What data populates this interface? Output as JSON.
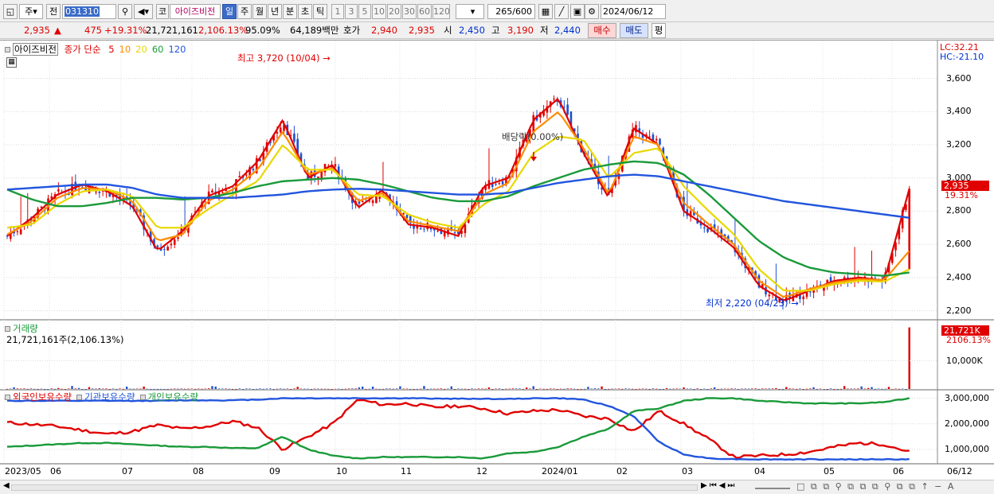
{
  "toolbar": {
    "market_type": "주",
    "prev_label": "전",
    "code": "031310",
    "market_badge": "코",
    "stock_name": "아이즈비전",
    "period_tabs": [
      "일",
      "주",
      "월",
      "년",
      "분",
      "초",
      "틱"
    ],
    "intervals": [
      "1",
      "3",
      "5",
      "10",
      "20",
      "30",
      "60",
      "120"
    ],
    "count": "265",
    "count_total": "/600",
    "date": "2024/06/12"
  },
  "quote": {
    "price": "2,935",
    "change_symbol": "▲",
    "change": "475",
    "change_pct": "+19.31%",
    "volume": "21,721,161",
    "volume_pct": "2,106.13%",
    "ratio": "95.09%",
    "amount": "64,189백만",
    "ask_label": "호가",
    "ask1": "2,940",
    "bid1": "2,935",
    "open_label": "시",
    "open": "2,450",
    "high_label": "고",
    "high": "3,190",
    "low_label": "저",
    "low": "2,440",
    "buy_btn": "매수",
    "sell_btn": "매도",
    "avg_btn": "평"
  },
  "price_panel": {
    "stock_name": "아이즈비전",
    "ma_label": "종가 단순",
    "ma_periods": [
      {
        "label": "5",
        "color": "#e00000"
      },
      {
        "label": "10",
        "color": "#ff8c00"
      },
      {
        "label": "20",
        "color": "#e8d800"
      },
      {
        "label": "60",
        "color": "#1a9a3a"
      },
      {
        "label": "120",
        "color": "#2255dd"
      }
    ],
    "high_annotation": "최고 3,720 (10/04)",
    "low_annotation": "최저 2,220 (04/23)",
    "dividend_annotation": "배당락(0.00%)",
    "lc_label": "LC:32.21",
    "hc_label": "HC:-21.10",
    "current_price_tag": "2,935",
    "current_pct_tag": "19.31%",
    "y_ticks": [
      "3,600",
      "3,400",
      "3,200",
      "3,000",
      "2,800",
      "2,600",
      "2,400",
      "2,200"
    ]
  },
  "volume_panel": {
    "title": "거래량",
    "value_text": "21,721,161주(2,106.13%)",
    "tag_value": "21,721K",
    "tag_pct": "2106.13%",
    "y_tick": "10,000K"
  },
  "holdings_panel": {
    "legend": [
      {
        "label": "외국인보유수량",
        "color": "#e00000"
      },
      {
        "label": "기관보유수량",
        "color": "#2255dd"
      },
      {
        "label": "개인보유수량",
        "color": "#1a9a3a"
      }
    ],
    "y_ticks": [
      "3,000,000",
      "2,000,000",
      "1,000,000"
    ]
  },
  "x_axis": [
    "2023/05",
    "06",
    "07",
    "08",
    "09",
    "10",
    "11",
    "12",
    "2024/01",
    "02",
    "03",
    "04",
    "05",
    "06",
    "06/12"
  ],
  "chart_data": {
    "type": "line",
    "title": "아이즈비전",
    "ylim": [
      2150,
      3780
    ],
    "x_range": [
      "2023/05",
      "2024/06/12"
    ],
    "series": [
      {
        "name": "5",
        "values": [
          2650,
          2760,
          2900,
          2960,
          2920,
          2830,
          2560,
          2680,
          2890,
          2950,
          3100,
          3350,
          3000,
          3080,
          2820,
          2930,
          2720,
          2700,
          2650,
          2950,
          3000,
          3350,
          3480,
          3150,
          2880,
          3300,
          3200,
          2800,
          2700,
          2580,
          2350,
          2260,
          2320,
          2380,
          2400,
          2380,
          2935
        ]
      },
      {
        "name": "10",
        "values": [
          2660,
          2740,
          2880,
          2940,
          2930,
          2860,
          2620,
          2660,
          2860,
          2930,
          3050,
          3280,
          3020,
          3060,
          2860,
          2910,
          2740,
          2710,
          2680,
          2900,
          2970,
          3280,
          3400,
          3180,
          2900,
          3250,
          3200,
          2850,
          2720,
          2600,
          2380,
          2280,
          2330,
          2370,
          2390,
          2385,
          2560
        ]
      },
      {
        "name": "20",
        "values": [
          2700,
          2720,
          2840,
          2920,
          2930,
          2890,
          2700,
          2700,
          2810,
          2900,
          2980,
          3200,
          3050,
          3050,
          2900,
          2890,
          2780,
          2730,
          2700,
          2840,
          2920,
          3150,
          3250,
          3230,
          3000,
          3150,
          3180,
          2950,
          2800,
          2660,
          2450,
          2320,
          2320,
          2360,
          2380,
          2375,
          2450
        ]
      },
      {
        "name": "60",
        "values": [
          2930,
          2870,
          2830,
          2830,
          2850,
          2880,
          2880,
          2870,
          2880,
          2910,
          2950,
          2980,
          2990,
          3000,
          2990,
          2960,
          2920,
          2880,
          2860,
          2860,
          2890,
          2950,
          3000,
          3050,
          3080,
          3100,
          3090,
          3020,
          2900,
          2760,
          2620,
          2520,
          2460,
          2430,
          2420,
          2410,
          2430
        ]
      },
      {
        "name": "120",
        "values": [
          2930,
          2940,
          2950,
          2960,
          2960,
          2940,
          2900,
          2880,
          2880,
          2880,
          2890,
          2900,
          2920,
          2930,
          2935,
          2930,
          2920,
          2910,
          2900,
          2900,
          2910,
          2940,
          2970,
          2990,
          3010,
          3020,
          3010,
          2980,
          2950,
          2920,
          2890,
          2860,
          2840,
          2820,
          2800,
          2780,
          2760
        ]
      }
    ],
    "holdings": {
      "ylim": [
        500000,
        3300000
      ],
      "series": [
        {
          "name": "외국인보유수량",
          "values": [
            2050000,
            1980000,
            1900000,
            1750000,
            1600000,
            1700000,
            1950000,
            1800000,
            1900000,
            2100000,
            1850000,
            1000000,
            1500000,
            2000000,
            2950000,
            2750000,
            2800000,
            2650000,
            2700000,
            2600000,
            2400000,
            2500000,
            2550000,
            2300000,
            2200000,
            1700000,
            2500000,
            2000000,
            1400000,
            700000,
            750000,
            800000,
            900000,
            1100000,
            1250000,
            1200000,
            900000
          ]
        },
        {
          "name": "기관보유수량",
          "values": [
            2900000,
            2900000,
            2900000,
            2900000,
            2900000,
            2900000,
            2900000,
            2920000,
            2920000,
            2920000,
            2950000,
            3000000,
            3000000,
            3000000,
            3000000,
            3000000,
            3000000,
            2990000,
            2980000,
            2980000,
            2970000,
            3000000,
            3000000,
            2950000,
            2700000,
            2300000,
            1300000,
            800000,
            650000,
            620000,
            610000,
            610000,
            610000,
            610000,
            610000,
            610000,
            610000
          ]
        },
        {
          "name": "개인보유수량",
          "values": [
            1100000,
            1150000,
            1200000,
            1250000,
            1250000,
            1200000,
            1150000,
            1100000,
            1100000,
            1050000,
            1050000,
            1500000,
            1000000,
            750000,
            650000,
            700000,
            700000,
            700000,
            700000,
            650000,
            850000,
            900000,
            1100000,
            1500000,
            1800000,
            2500000,
            2600000,
            2900000,
            3000000,
            3000000,
            2900000,
            2850000,
            2800000,
            2800000,
            2800000,
            2850000,
            3000000
          ]
        }
      ]
    }
  }
}
